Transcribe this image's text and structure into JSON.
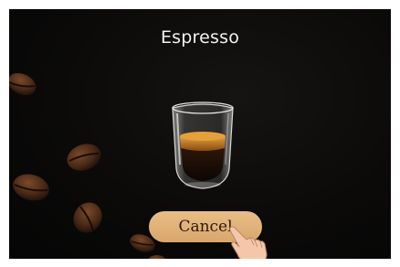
{
  "screen": {
    "title": "Espresso",
    "cancel_label": "Cancel",
    "background_color": "#0b0a09",
    "button_color": "#e3b47b"
  },
  "icons": {
    "cup": "espresso-cup-icon",
    "hand": "pointing-hand-icon",
    "bean": "coffee-bean-icon"
  }
}
